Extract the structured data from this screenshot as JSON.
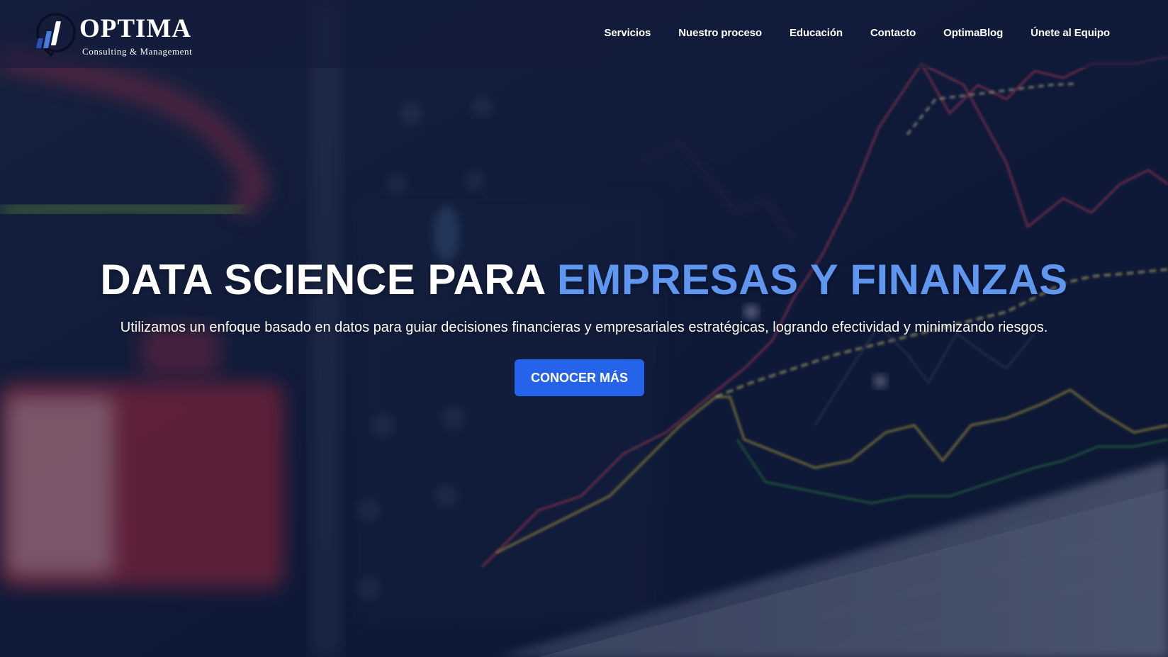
{
  "brand": {
    "name": "OPTIMA",
    "tagline": "Consulting & Management",
    "logo_icon": "bar-chart-magnifier-icon"
  },
  "nav": {
    "items": [
      {
        "label": "Servicios"
      },
      {
        "label": "Nuestro proceso"
      },
      {
        "label": "Educación"
      },
      {
        "label": "Contacto"
      },
      {
        "label": "OptimaBlog"
      },
      {
        "label": "Únete al Equipo"
      }
    ]
  },
  "hero": {
    "title_white": "DATA SCIENCE PARA",
    "title_accent": "EMPRESAS Y FINANZAS",
    "subtitle": "Utilizamos un enfoque basado en datos para guiar decisiones financieras y empresariales estratégicas, logrando efectividad y minimizando riesgos.",
    "cta_label": "CONOCER MÁS"
  },
  "colors": {
    "accent": "#5f97f0",
    "button": "#2563eb",
    "background": "#0c1630",
    "text": "#ffffff"
  }
}
